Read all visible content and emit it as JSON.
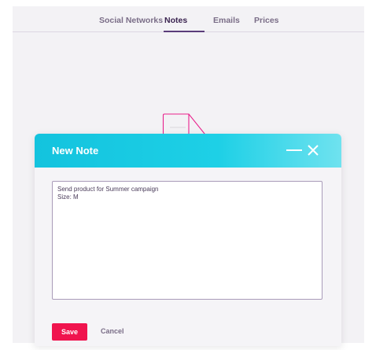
{
  "tabs": [
    {
      "label": "Social Networks",
      "active": false
    },
    {
      "label": "Notes",
      "active": true
    },
    {
      "label": "Emails",
      "active": false
    },
    {
      "label": "Prices",
      "active": false
    }
  ],
  "empty_state": {
    "icon": "document-icon"
  },
  "modal": {
    "title": "New Note",
    "header_gradient": [
      "#13c3de",
      "#6fe2ef"
    ],
    "minimize_icon": "minimize-icon",
    "close_icon": "close-icon",
    "note_text": "Send product for Summer campaign\nSize: M",
    "save_label": "Save",
    "save_color": "#f0144e",
    "cancel_label": "Cancel"
  }
}
